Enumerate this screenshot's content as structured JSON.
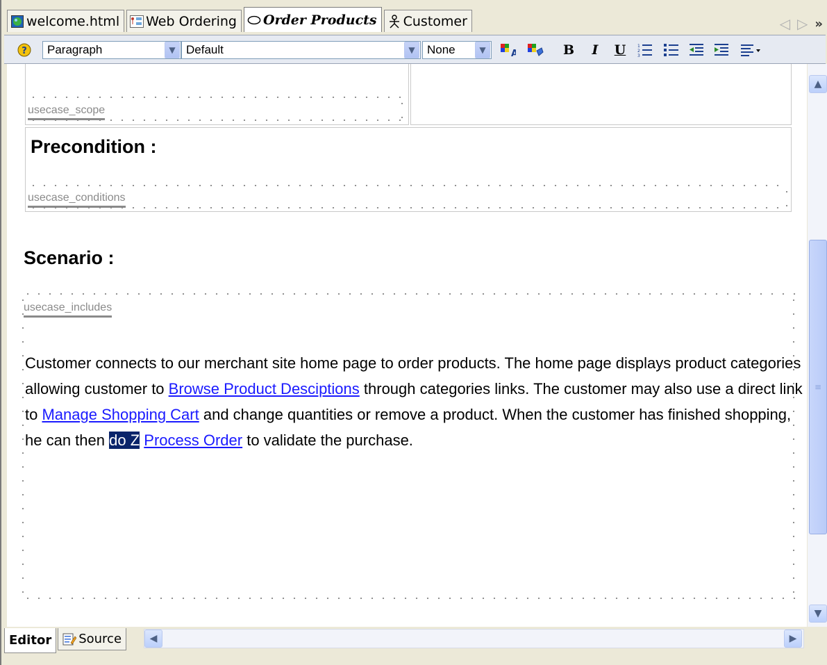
{
  "tabs": [
    {
      "label": "welcome.html",
      "icon": "globe-icon",
      "active": false
    },
    {
      "label": "Web Ordering",
      "icon": "diagram-icon",
      "active": false
    },
    {
      "label": "Order Products",
      "icon": "usecase-oval-icon",
      "active": true
    },
    {
      "label": "Customer",
      "icon": "actor-icon",
      "active": false
    }
  ],
  "toolbar": {
    "paragraph_style": "Paragraph",
    "font": "Default",
    "size": "None",
    "bold": "B",
    "italic": "I",
    "underline": "U"
  },
  "document": {
    "scope_tag": "usecase_scope",
    "precondition_heading": "Precondition :",
    "conditions_tag": "usecase_conditions",
    "scenario_heading": "Scenario :",
    "includes_tag": "usecase_includes",
    "scenario_text": {
      "t1": "Customer connects to our merchant site home page to order products. The home page displays product categories allowing customer to ",
      "link1": "Browse Product Desciptions",
      "t2": " through categories links. The customer may also use a direct link to ",
      "link2": "Manage Shopping Cart",
      "t3": " and change quantities or remove a product. When the customer has finished shopping, he can then ",
      "selected": "do Z",
      "t4": " ",
      "link3": "Process Order",
      "t5": " to validate the purchase."
    }
  },
  "bottom_tabs": [
    {
      "label": "Editor",
      "active": true
    },
    {
      "label": "Source",
      "icon": "source-edit-icon",
      "active": false
    }
  ],
  "colors": {
    "link": "#1a1aff",
    "selection": "#0a246a",
    "scrollbar": "#c8d6fb"
  }
}
